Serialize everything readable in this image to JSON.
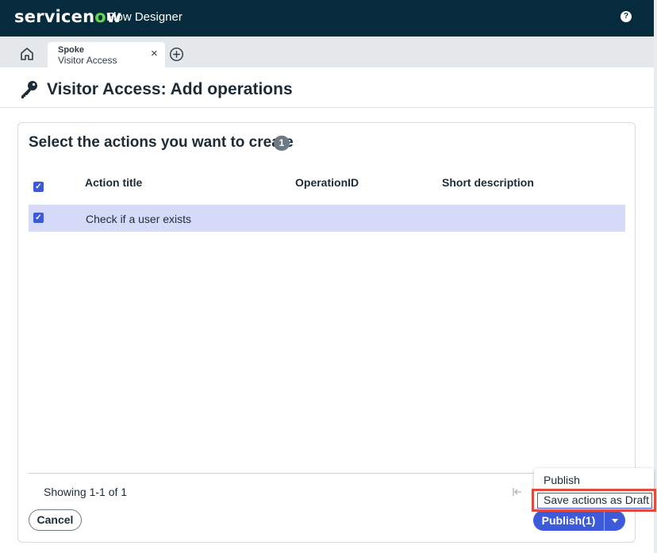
{
  "topbar": {
    "brand_prefix": "servicen",
    "brand_o": "o",
    "brand_suffix": "w",
    "app_name": "Flow Designer",
    "help_glyph": "?"
  },
  "tabs": {
    "active_tab": {
      "kicker": "Spoke",
      "title": "Visitor Access",
      "close_glyph": "×"
    }
  },
  "page": {
    "title": "Visitor Access: Add operations"
  },
  "card": {
    "title": "Select the actions you want to create",
    "count": "1",
    "columns": [
      "Action title",
      "OperationID",
      "Short description"
    ],
    "rows": [
      {
        "action_title": "Check if a user exists",
        "operation_id": "",
        "short_description": "",
        "selected": true
      }
    ],
    "select_all_checked": true,
    "check_glyph": "✓",
    "showing": "Showing 1-1 of 1"
  },
  "buttons": {
    "cancel": "Cancel",
    "publish": "Publish(1)"
  },
  "menu": {
    "items": [
      "Publish",
      "Save actions as Draft"
    ]
  },
  "colors": {
    "topbar": "#062b3d",
    "accent": "#3d5bd9",
    "selected_row": "#d5daf8",
    "highlight": "#e04b3f",
    "now_green": "#62d84e"
  },
  "icons": [
    "home-icon",
    "add-tab-icon",
    "key-icon",
    "help-icon",
    "first-page-icon",
    "caret-down-icon"
  ]
}
